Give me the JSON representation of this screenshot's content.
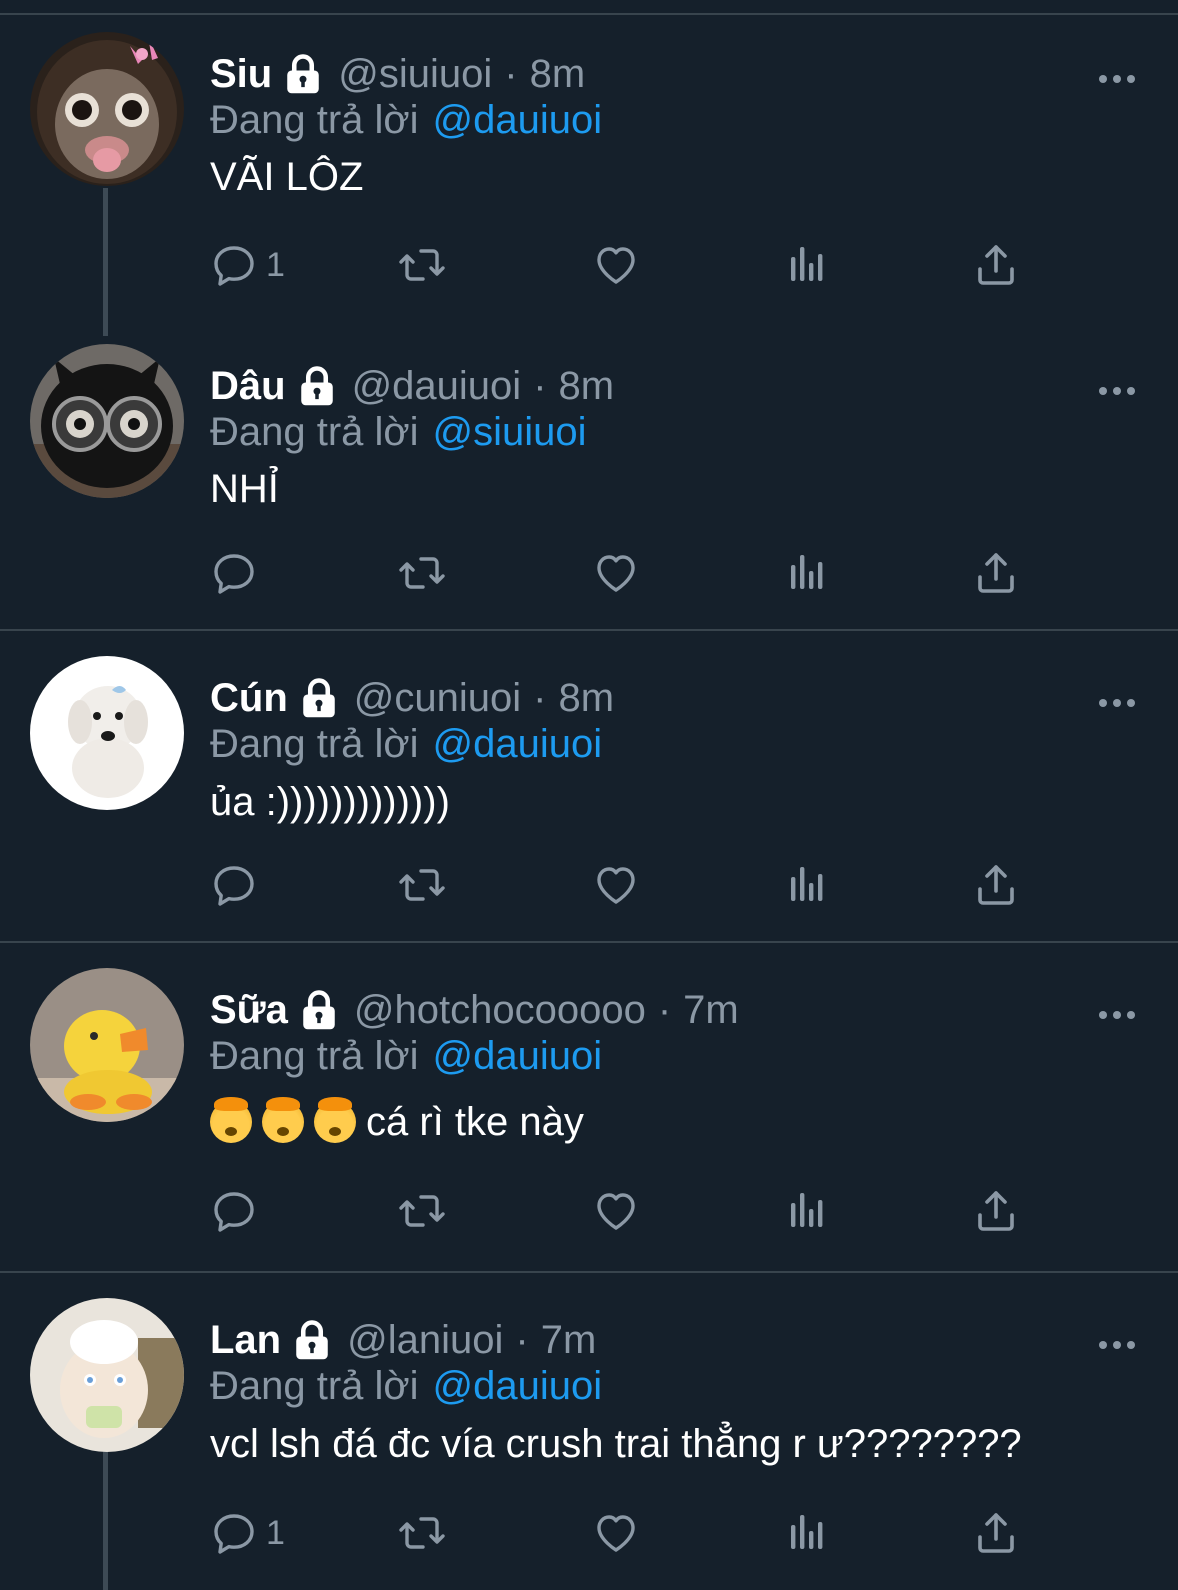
{
  "reply_prefix": "Đang trả lời",
  "tweets": [
    {
      "name": "Siu",
      "handle": "@siuiuoi",
      "sep": "·",
      "time": "8m",
      "reply_to": "@dauiuoi",
      "text": "VÃI LÔZ",
      "reply_count": "1"
    },
    {
      "name": "Dâu",
      "handle": "@dauiuoi",
      "sep": "·",
      "time": "8m",
      "reply_to": "@siuiuoi",
      "text": "NHỈ",
      "reply_count": ""
    },
    {
      "name": "Cún",
      "handle": "@cuniuoi",
      "sep": "·",
      "time": "8m",
      "reply_to": "@dauiuoi",
      "text": "ủa :)))))))))))))",
      "reply_count": ""
    },
    {
      "name": "Sữa",
      "handle": "@hotchocooooo",
      "sep": "·",
      "time": "7m",
      "reply_to": "@dauiuoi",
      "text": "cá rì tke này",
      "emoji": "🤯🤯🤯",
      "reply_count": ""
    },
    {
      "name": "Lan",
      "handle": "@laniuoi",
      "sep": "·",
      "time": "7m",
      "reply_to": "@dauiuoi",
      "text": "vcl lsh đá đc vía crush trai thẳng r ư????????",
      "reply_count": "1"
    }
  ],
  "icons": {
    "lock": "lock-icon",
    "more": "more-icon",
    "reply": "reply-icon",
    "retweet": "retweet-icon",
    "like": "heart-icon",
    "views": "views-icon",
    "share": "share-icon"
  },
  "colors": {
    "background": "#15202b",
    "text": "#ffffff",
    "muted": "#8b98a5",
    "link": "#1d9bf0",
    "divider": "#38444d"
  }
}
